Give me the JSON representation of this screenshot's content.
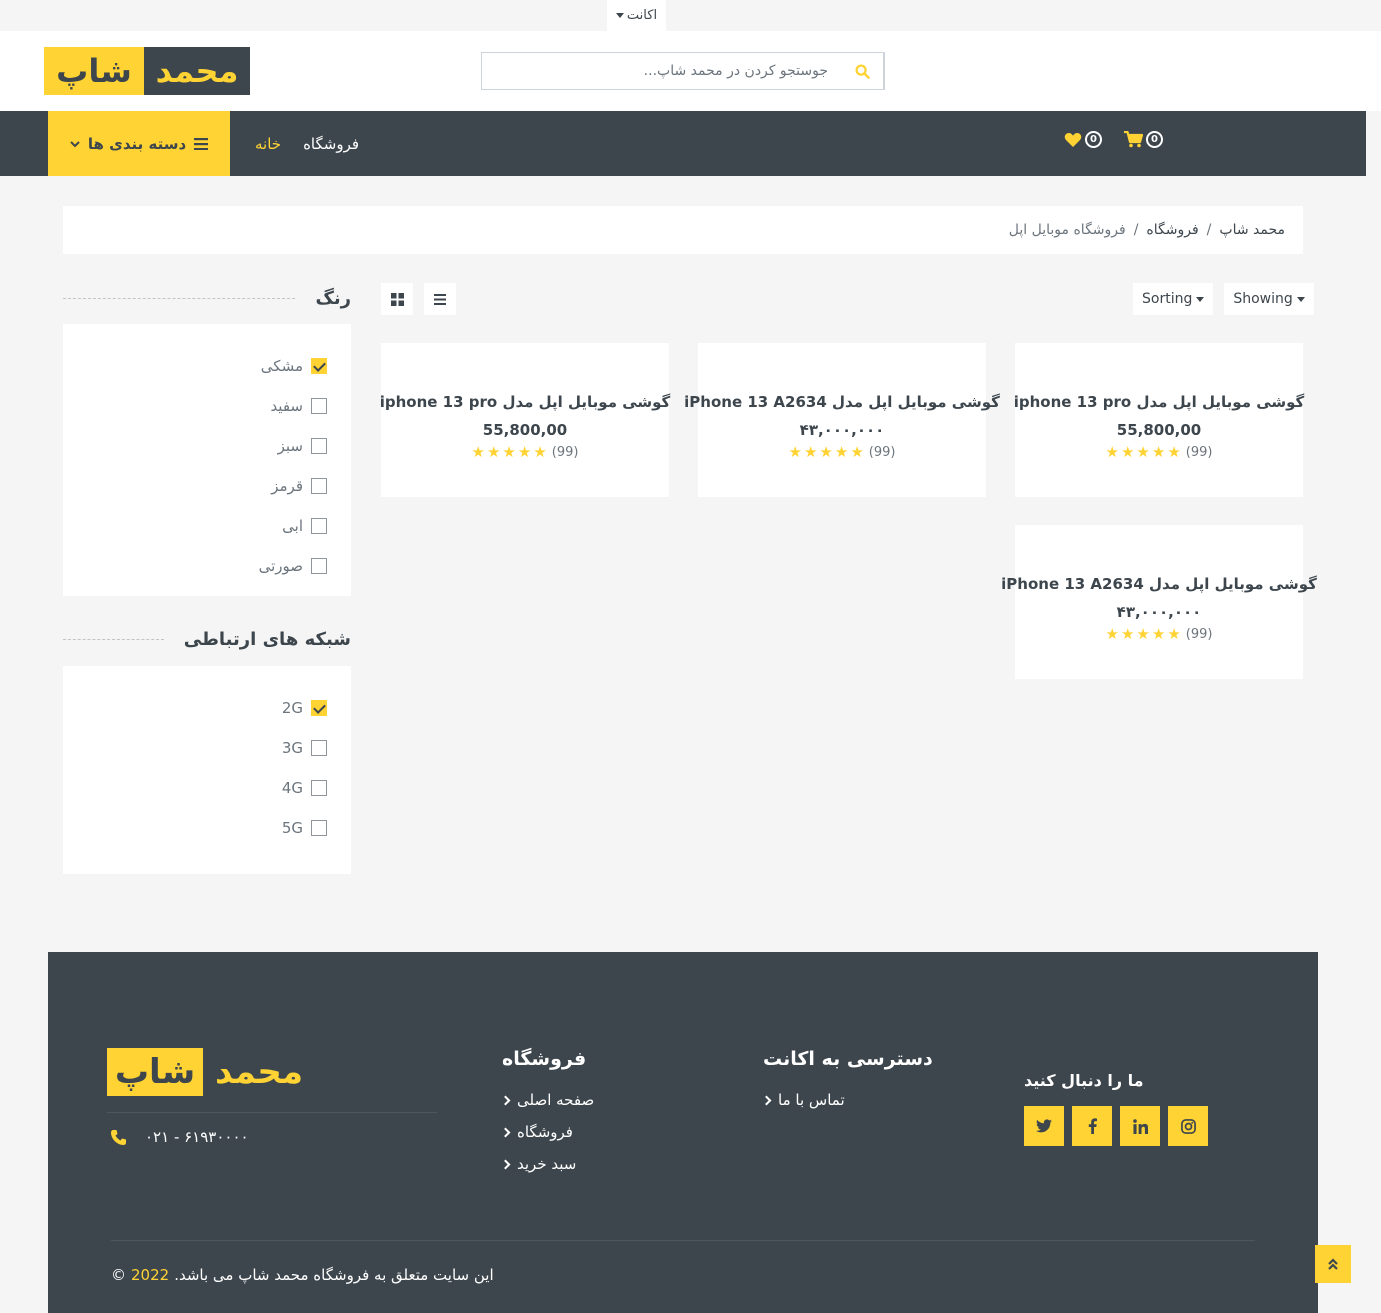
{
  "topbar": {
    "account_label": "اکانت"
  },
  "header": {
    "logo_part1": "محمد",
    "logo_part2": "شاپ",
    "search_placeholder": "...جوستجو کردن در محمد شاپ"
  },
  "nav": {
    "categories_label": "دسته بندی ها",
    "home": "خانه",
    "shop": "فروشگاه",
    "wishlist_count": "0",
    "cart_count": "0"
  },
  "breadcrumb": {
    "items": [
      "محمد شاپ",
      "فروشگاه"
    ],
    "current": "فروشگاه موبایل اپل",
    "separator": "/"
  },
  "filters": {
    "color": {
      "title": "رنگ",
      "items": [
        {
          "label": "مشکی",
          "checked": true
        },
        {
          "label": "سفید",
          "checked": false
        },
        {
          "label": "سبز",
          "checked": false
        },
        {
          "label": "قرمز",
          "checked": false
        },
        {
          "label": "ابی",
          "checked": false
        },
        {
          "label": "صورتی",
          "checked": false
        }
      ]
    },
    "network": {
      "title": "شبکه های ارتباطی",
      "items": [
        {
          "label": "2G",
          "checked": true
        },
        {
          "label": "3G",
          "checked": false
        },
        {
          "label": "4G",
          "checked": false
        },
        {
          "label": "5G",
          "checked": false
        }
      ]
    }
  },
  "toolbar": {
    "sorting": "Sorting",
    "showing": "Showing"
  },
  "products": [
    {
      "name": "گوشی موبایل اپل مدل iphone 13 pro",
      "price": "55,800,00",
      "reviews": "(99)",
      "stars": 5
    },
    {
      "name": "گوشی موبایل اپل مدل iPhone 13 A2634",
      "price": "۴۳,۰۰۰,۰۰۰",
      "reviews": "(99)",
      "stars": 5
    },
    {
      "name": "گوشی موبایل اپل مدل iphone 13 pro",
      "price": "55,800,00",
      "reviews": "(99)",
      "stars": 5
    },
    {
      "name": "گوشی موبایل اپل مدل iPhone 13 A2634",
      "price": "۴۳,۰۰۰,۰۰۰",
      "reviews": "(99)",
      "stars": 5
    }
  ],
  "footer": {
    "logo_part1": "محمد",
    "logo_part2": "شاپ",
    "phone": "۰۲۱ - ۶۱۹۳۰۰۰۰",
    "shop_title": "فروشگاه",
    "shop_links": [
      "صفحه اصلی",
      "فروشگاه",
      "سبد خرید"
    ],
    "account_title": "دسترسی به اکانت",
    "account_links": [
      "تماس با ما"
    ],
    "follow_title": "ما را دنبال کنید",
    "social": [
      "twitter",
      "facebook",
      "linkedin",
      "instagram"
    ],
    "copyright_text": ".این سایت متعلق به فروشگاه محمد شاپ می باشد",
    "copyright_year": "2022",
    "copyright_symbol": "©"
  },
  "colors": {
    "accent": "#ffd333",
    "dark": "#3d464d",
    "bg": "#f5f5f5"
  }
}
